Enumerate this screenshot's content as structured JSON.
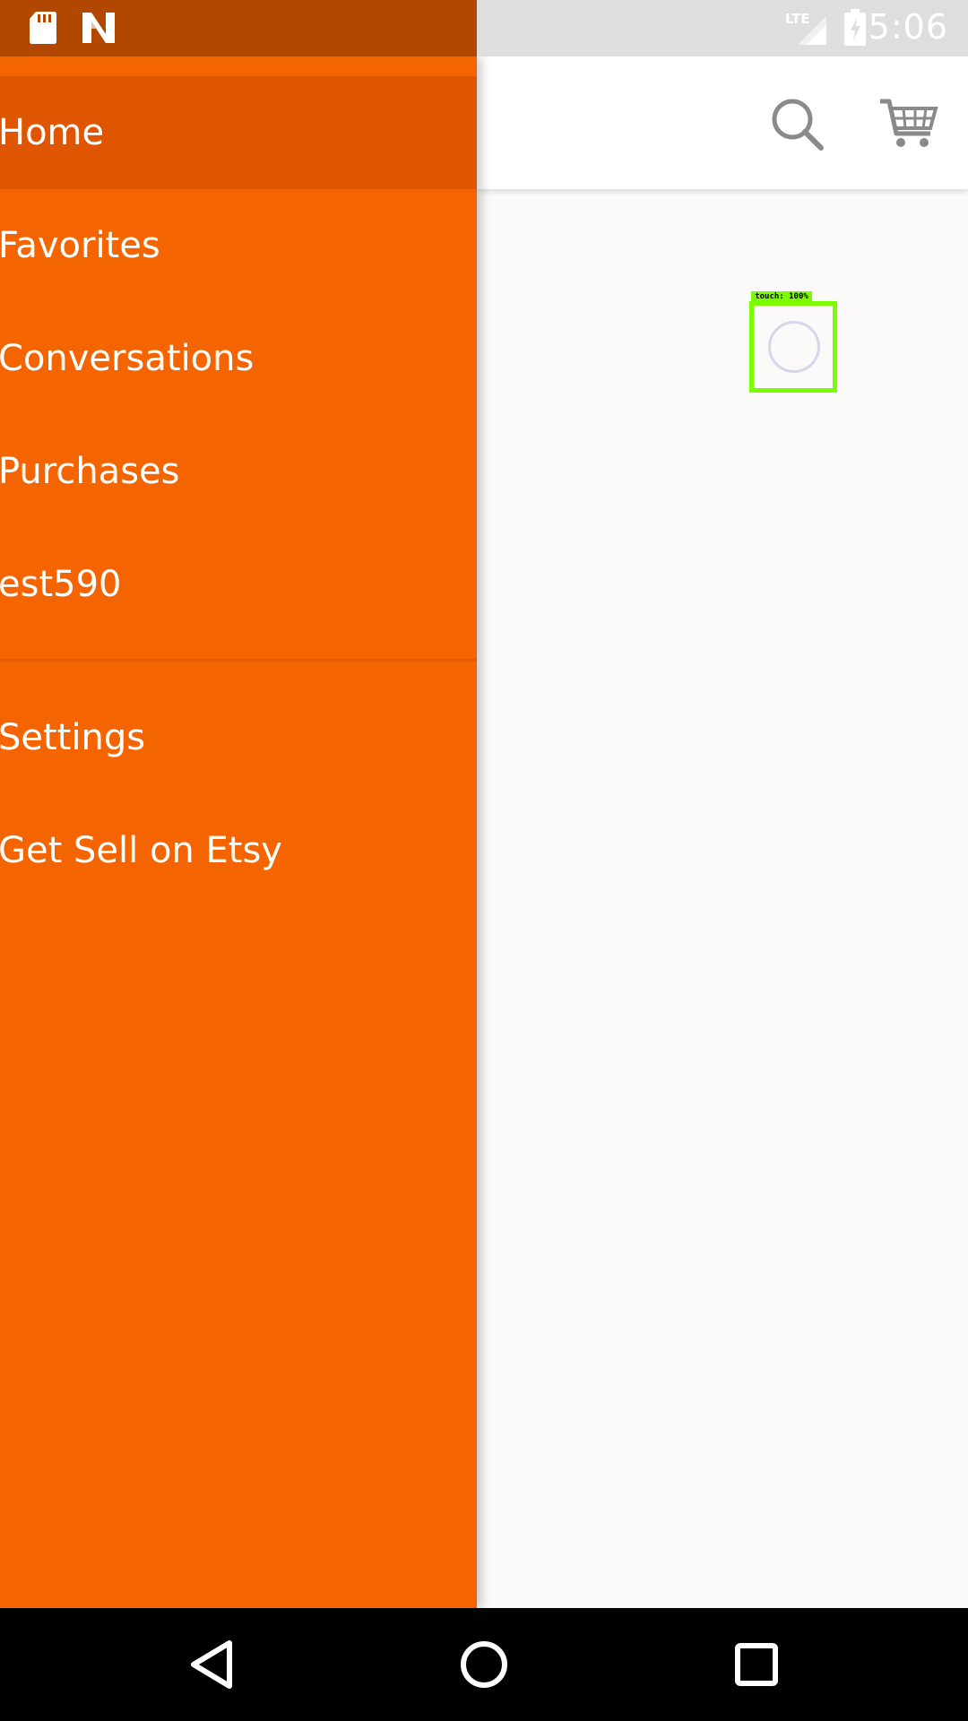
{
  "status_bar": {
    "time": "5:06",
    "network": "LTE",
    "icons": [
      "sd-card-icon",
      "n-notification-icon",
      "lte-signal-icon",
      "battery-charging-icon"
    ]
  },
  "app_bar": {
    "icons": [
      "search-icon",
      "cart-icon"
    ]
  },
  "drawer": {
    "items": [
      {
        "label": "Home",
        "active": true
      },
      {
        "label": "Favorites"
      },
      {
        "label": "Conversations"
      },
      {
        "label": "Purchases"
      },
      {
        "label": "est590"
      },
      {
        "label": "Settings"
      },
      {
        "label": "Get Sell on Etsy"
      }
    ]
  },
  "touch_overlay": {
    "label": "touch: 100%"
  },
  "nav_bar": {
    "icons": [
      "back-icon",
      "home-icon",
      "recents-icon"
    ]
  },
  "colors": {
    "drawer": "#f46400",
    "drawer_active": "#e05500",
    "status_bar_drawer": "#b24700",
    "touch_highlight": "#7cfc00"
  }
}
